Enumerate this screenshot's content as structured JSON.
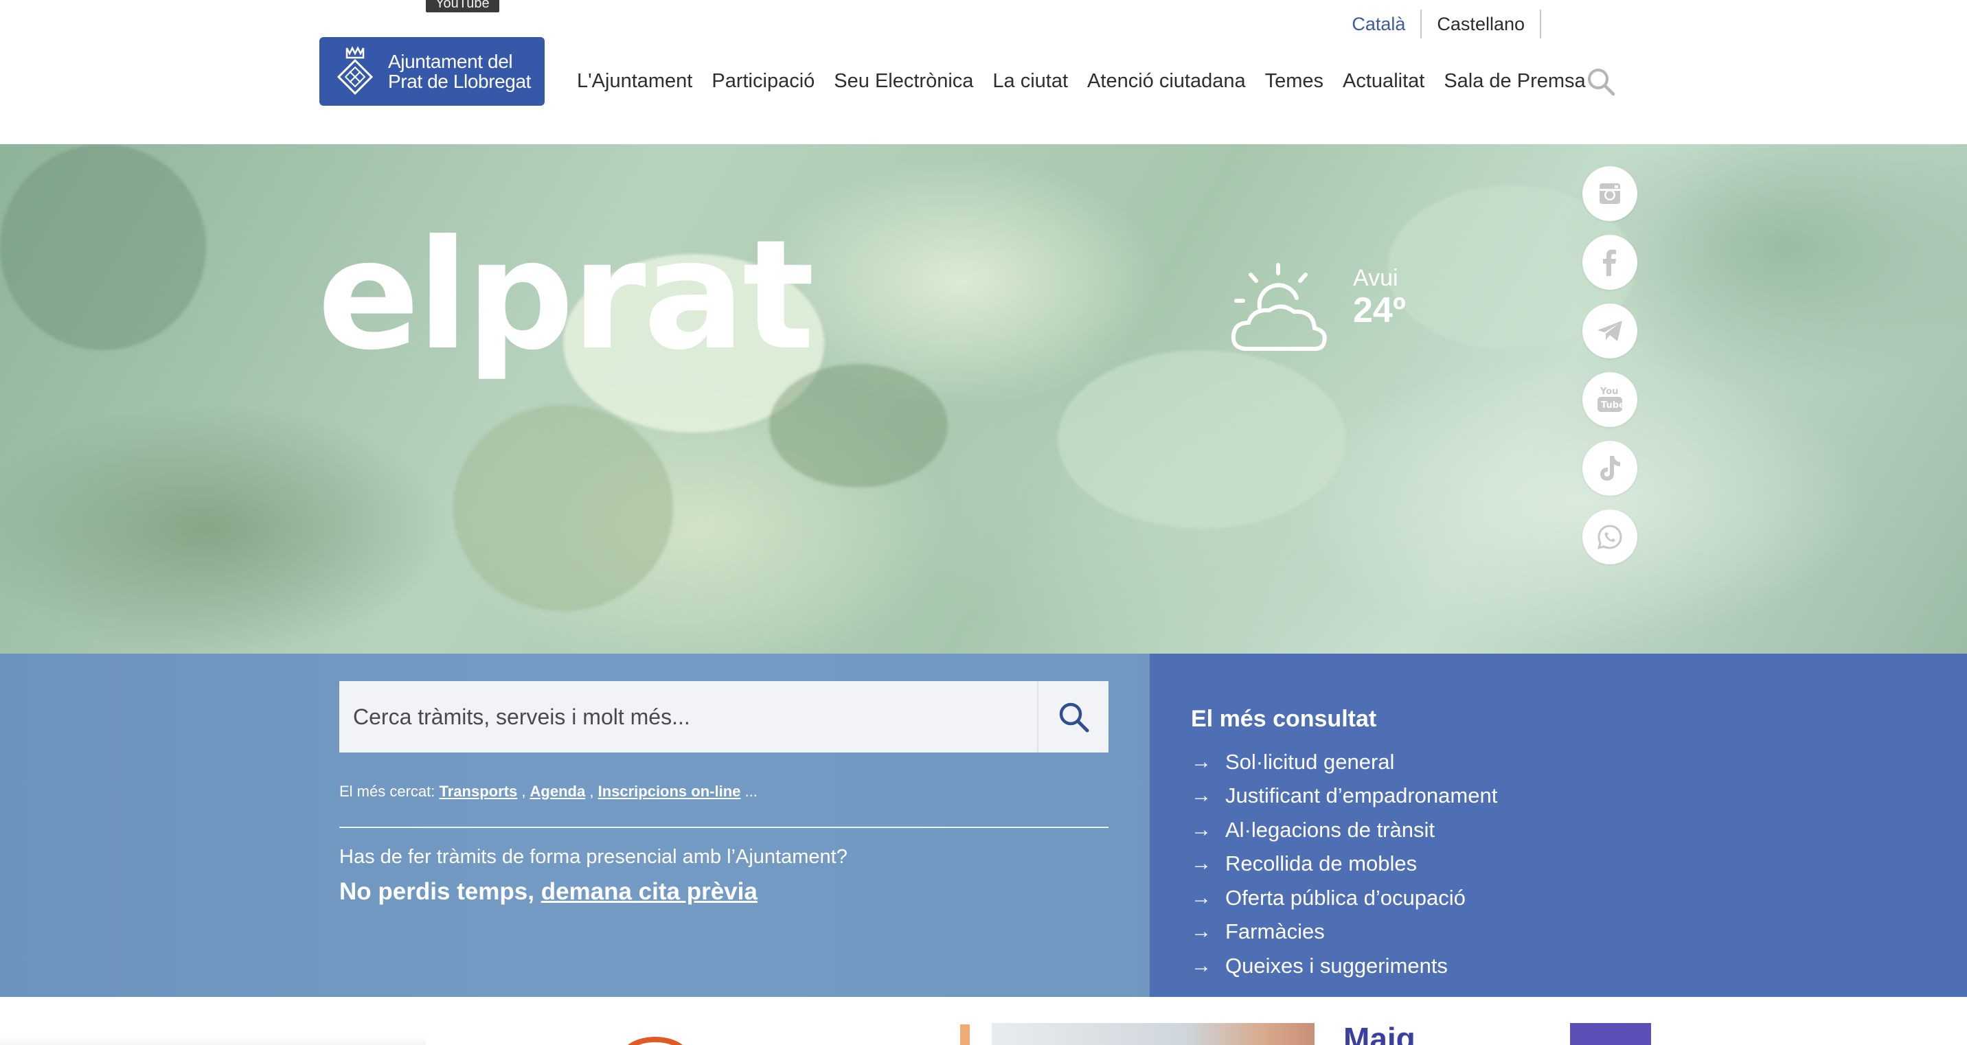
{
  "tooltip": "YouTube",
  "languages": [
    {
      "label": "Català",
      "active": true
    },
    {
      "label": "Castellano",
      "active": false
    }
  ],
  "logo": {
    "line1": "Ajuntament del",
    "line2": "Prat de Llobregat"
  },
  "nav": [
    "L'Ajuntament",
    "Participació",
    "Seu Electrònica",
    "La ciutat",
    "Atenció ciutadana",
    "Temes",
    "Actualitat",
    "Sala de Premsa"
  ],
  "hero": {
    "brand": "elprat",
    "weather": {
      "day": "Avui",
      "temp": "24º",
      "icon": "partly-cloudy-icon"
    }
  },
  "social": [
    {
      "name": "instagram-icon"
    },
    {
      "name": "facebook-icon"
    },
    {
      "name": "telegram-icon"
    },
    {
      "name": "youtube-icon"
    },
    {
      "name": "tiktok-icon"
    },
    {
      "name": "whatsapp-icon"
    }
  ],
  "search": {
    "placeholder": "Cerca tràmits, serveis i molt més...",
    "most_searched_label": "El més cercat:",
    "most_searched": [
      "Transports",
      "Agenda",
      "Inscripcions on-line"
    ],
    "ellipsis": "..."
  },
  "appointment": {
    "question": "Has de fer tràmits de forma presencial amb l’Ajuntament?",
    "lead": "No perdis temps,",
    "link": "demana cita prèvia"
  },
  "most_consulted": {
    "title": "El més consultat",
    "items": [
      "Sol·licitud general",
      "Justificant d’empadronament",
      "Al·legacions de trànsit",
      "Recollida de mobles",
      "Oferta pública d’ocupació",
      "Farmàcies",
      "Queixes i suggeriments",
      ""
    ]
  },
  "banners": {
    "maig_text": "Maig"
  },
  "colors": {
    "brand_blue": "#3558a8",
    "band_left": "#6f97c0",
    "band_right": "#4f6fb4",
    "active_lang": "#3d5a9e"
  }
}
